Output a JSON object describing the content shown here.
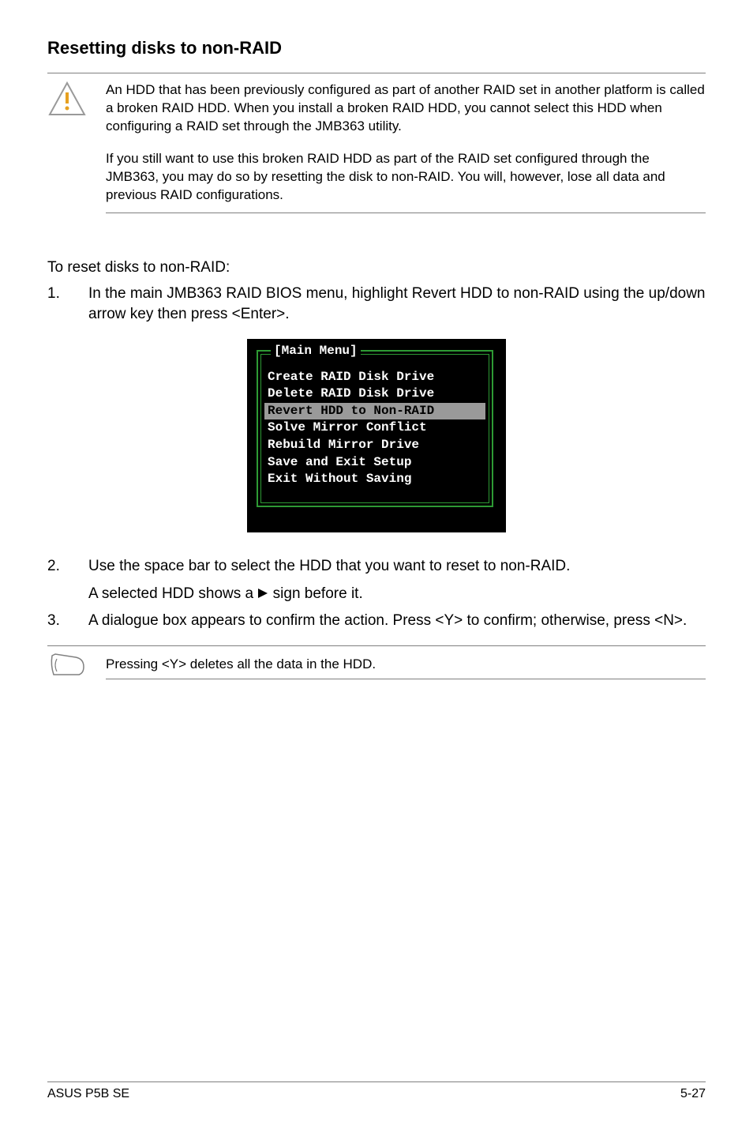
{
  "heading": "Resetting disks to non-RAID",
  "warning": {
    "p1": "An HDD that has been previously configured as part of another RAID set in another platform is called a broken RAID HDD. When you install a broken RAID HDD, you cannot select this HDD when configuring a RAID set through the JMB363 utility.",
    "p2": "If you still want to use this broken RAID HDD as part of the RAID set configured through the JMB363, you may do so by resetting the disk to non-RAID. You will, however, lose all data and previous RAID configurations."
  },
  "intro": "To reset disks to non-RAID:",
  "step1": {
    "num": "1.",
    "text": "In the main JMB363 RAID BIOS menu, highlight Revert HDD to non-RAID using the up/down arrow key then press <Enter>."
  },
  "bios": {
    "title": "[Main Menu]",
    "items": [
      "Create RAID Disk Drive",
      "Delete RAID Disk Drive",
      "Revert HDD to Non-RAID",
      "Solve Mirror Conflict",
      "Rebuild Mirror Drive",
      "Save and Exit Setup",
      "Exit Without Saving"
    ],
    "highlight_index": 2
  },
  "step2": {
    "num": "2.",
    "line1": "Use the space bar to select the HDD that you want to reset to non-RAID.",
    "line2_before": "A selected HDD shows a ",
    "line2_after": " sign before it."
  },
  "step3": {
    "num": "3.",
    "text": "A dialogue box appears to confirm the action. Press <Y> to confirm; otherwise, press <N>."
  },
  "note": "Pressing <Y> deletes all the data in the HDD.",
  "footer": {
    "left": "ASUS P5B SE",
    "right": "5-27"
  }
}
